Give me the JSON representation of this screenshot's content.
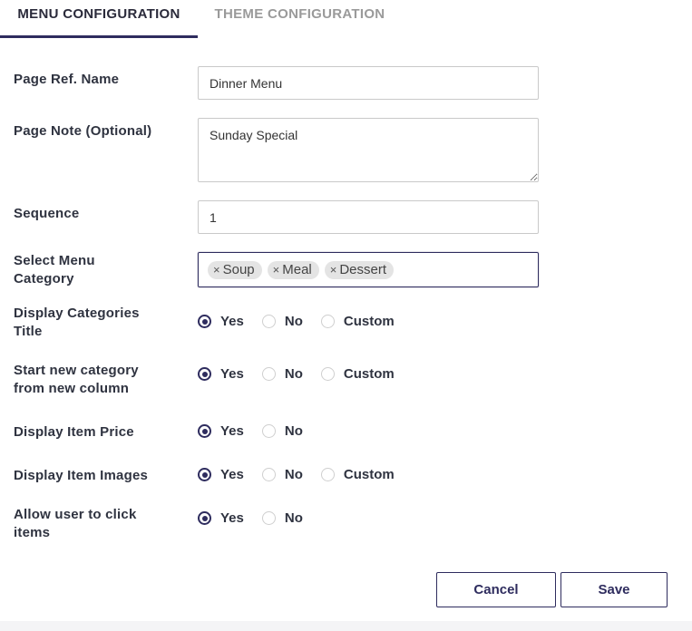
{
  "tabs": {
    "menu_configuration": "MENU CONFIGURATION",
    "theme_configuration": "THEME CONFIGURATION"
  },
  "form": {
    "page_ref_name": {
      "label": "Page Ref. Name",
      "value": "Dinner Menu"
    },
    "page_note": {
      "label": "Page Note (Optional)",
      "value": "Sunday Special"
    },
    "sequence": {
      "label": "Sequence",
      "value": "1"
    },
    "menu_category": {
      "label_line1": "Select Menu",
      "label_line2": "Category",
      "chips": [
        "Soup",
        "Meal",
        "Dessert"
      ],
      "remove_glyph": "×"
    },
    "display_categories_title": {
      "label_line1": "Display Categories",
      "label_line2": "Title",
      "options": [
        "Yes",
        "No",
        "Custom"
      ],
      "selected": "Yes"
    },
    "start_new_category": {
      "label_line1": "Start new category",
      "label_line2": "from new column",
      "options": [
        "Yes",
        "No",
        "Custom"
      ],
      "selected": "Yes"
    },
    "display_item_price": {
      "label": "Display Item Price",
      "options": [
        "Yes",
        "No"
      ],
      "selected": "Yes"
    },
    "display_item_images": {
      "label": "Display Item Images",
      "options": [
        "Yes",
        "No",
        "Custom"
      ],
      "selected": "Yes"
    },
    "allow_user_click": {
      "label_line1": "Allow user to click",
      "label_line2": "items",
      "options": [
        "Yes",
        "No"
      ],
      "selected": "Yes"
    }
  },
  "actions": {
    "cancel": "Cancel",
    "save": "Save"
  },
  "colors": {
    "accent": "#2e2c5e",
    "chip_bg": "#e4e4e4",
    "border": "#c9c9c9"
  }
}
